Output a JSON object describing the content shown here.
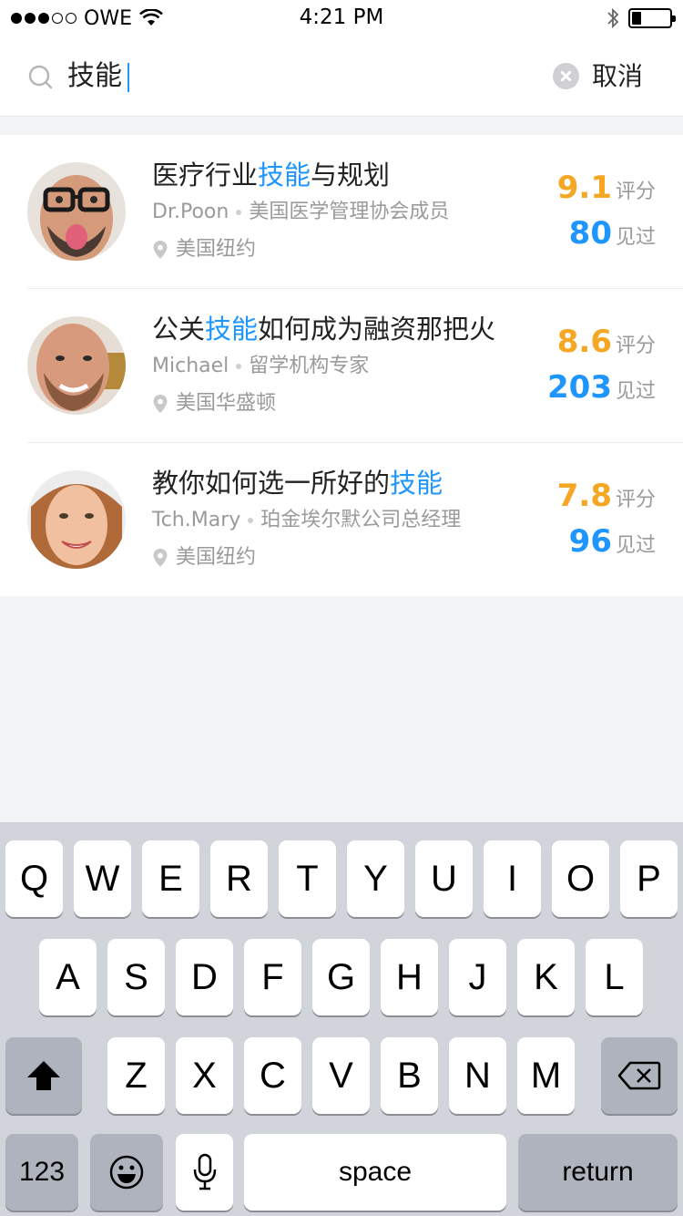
{
  "status_bar": {
    "carrier": "OWE",
    "time": "4:21 PM",
    "battery_level": 0.25
  },
  "search": {
    "query": "技能",
    "cancel_label": "取消"
  },
  "results": [
    {
      "title_before": "医疗行业",
      "title_highlight": "技能",
      "title_after": "与规划",
      "name": "Dr.Poon",
      "role": "美国医学管理协会成员",
      "location": "美国纽约",
      "score": "9.1",
      "score_label": "评分",
      "seen": "80",
      "seen_label": "见过"
    },
    {
      "title_before": "公关",
      "title_highlight": "技能",
      "title_after": "如何成为融资那把火",
      "name": "Michael",
      "role": "留学机构专家",
      "location": "美国华盛顿",
      "score": "8.6",
      "score_label": "评分",
      "seen": "203",
      "seen_label": "见过"
    },
    {
      "title_before": "教你如何选一所好的",
      "title_highlight": "技能",
      "title_after": "",
      "name": "Tch.Mary",
      "role": "珀金埃尔默公司总经理",
      "location": "美国纽约",
      "score": "7.8",
      "score_label": "评分",
      "seen": "96",
      "seen_label": "见过"
    }
  ],
  "keyboard": {
    "row1": [
      "Q",
      "W",
      "E",
      "R",
      "T",
      "Y",
      "U",
      "I",
      "O",
      "P"
    ],
    "row2": [
      "A",
      "S",
      "D",
      "F",
      "G",
      "H",
      "J",
      "K",
      "L"
    ],
    "row3": [
      "Z",
      "X",
      "C",
      "V",
      "B",
      "N",
      "M"
    ],
    "numbers_label": "123",
    "space_label": "space",
    "return_label": "return"
  },
  "colors": {
    "accent": "#1e95ff",
    "score": "#f5a623",
    "secondary_text": "#9a9a9a"
  }
}
